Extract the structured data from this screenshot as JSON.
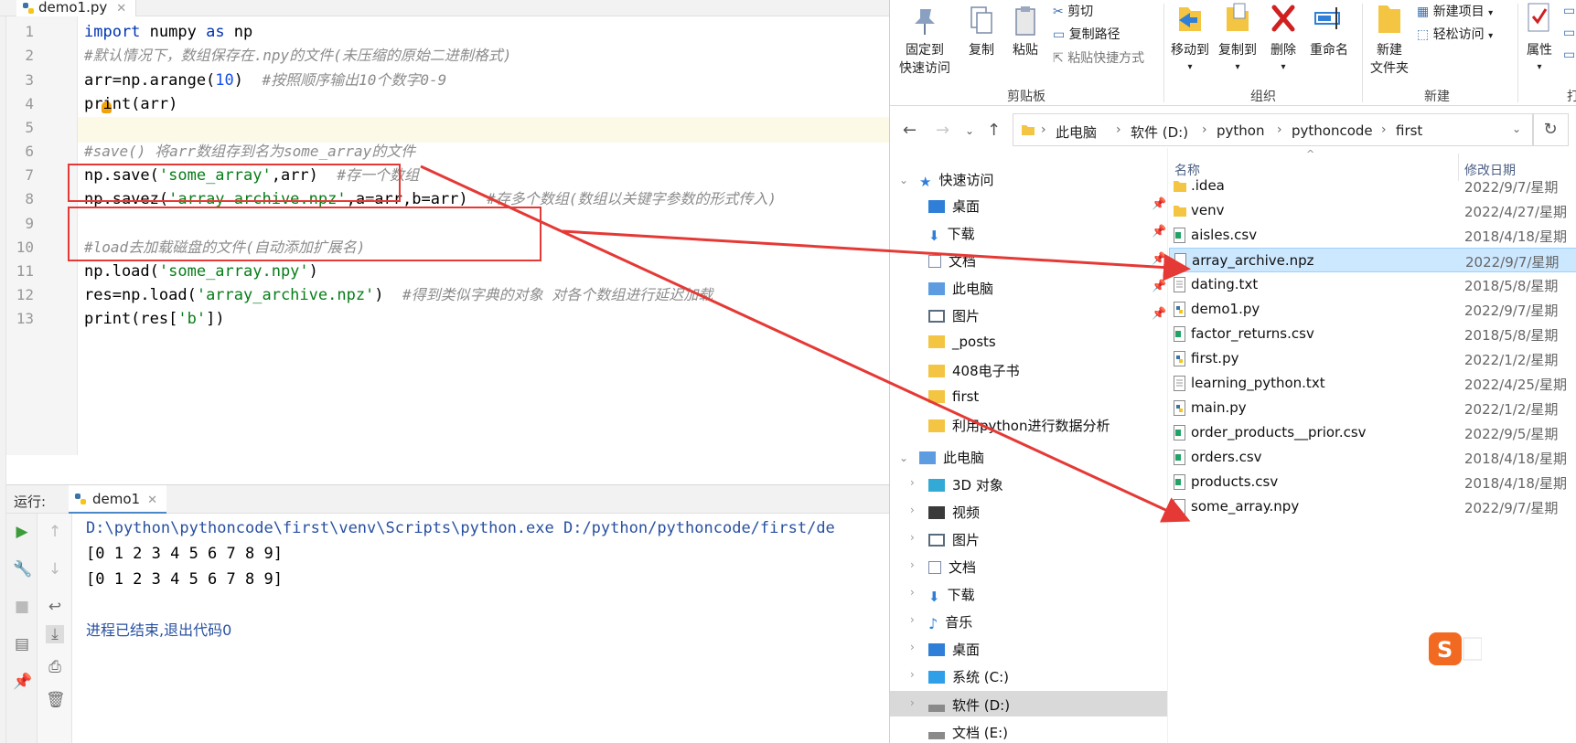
{
  "ide": {
    "tab": "demo1.py",
    "code_lines": [
      {
        "n": "1"
      },
      {
        "n": "2"
      },
      {
        "n": "3"
      },
      {
        "n": "4"
      },
      {
        "n": "5"
      },
      {
        "n": "6"
      },
      {
        "n": "7"
      },
      {
        "n": "8"
      },
      {
        "n": "9"
      },
      {
        "n": "10"
      },
      {
        "n": "11"
      },
      {
        "n": "12"
      },
      {
        "n": "13"
      }
    ],
    "code": {
      "l1": {
        "kw1": "import",
        "mid": " numpy ",
        "kw2": "as",
        "tail": " np"
      },
      "l2": "#默认情况下，数组保存在.npy的文件(未压缩的原始二进制格式)",
      "l3": {
        "a": "arr=np.arange(",
        "num": "10",
        "b": ")  ",
        "c": "#按照顺序输出10个数字0-9"
      },
      "l4": "print(arr)",
      "l6": "#save() 将arr数组存到名为some_array的文件",
      "l7": {
        "a": "np.save(",
        "s": "'some_array'",
        "b": ",arr)  ",
        "c": "#存一个数组"
      },
      "l8": {
        "a": "np.savez(",
        "s": "'array_archive.npz'",
        "b": ",a=arr,b=arr)  ",
        "c": "#存多个数组(数组以关键字参数的形式传入)"
      },
      "l10": "#load去加载磁盘的文件(自动添加扩展名)",
      "l11": {
        "a": "np.load(",
        "s": "'some_array.npy'",
        "b": ")"
      },
      "l12": {
        "a": "res=np.load(",
        "s": "'array_archive.npz'",
        "b": ")  ",
        "c": "#得到类似字典的对象 对各个数组进行延迟加载"
      },
      "l13": {
        "a": "print(res[",
        "s": "'b'",
        "b": "])"
      }
    },
    "run": {
      "label": "运行:",
      "tab": "demo1",
      "output": [
        "D:\\python\\pythoncode\\first\\venv\\Scripts\\python.exe D:/python/pythoncode/first/de",
        "[0 1 2 3 4 5 6 7 8 9]",
        "[0 1 2 3 4 5 6 7 8 9]",
        "进程已结束,退出代码0"
      ]
    }
  },
  "explorer": {
    "ribbon": {
      "pin": [
        "固定到",
        "快速访问"
      ],
      "copy": "复制",
      "paste": "粘贴",
      "cut": "剪切",
      "copy_path": "复制路径",
      "paste_shortcut": "粘贴快捷方式",
      "move_to": "移动到",
      "copy_to": "复制到",
      "delete": "删除",
      "rename": "重命名",
      "new_folder": [
        "新建",
        "文件夹"
      ],
      "new_item": "新建项目",
      "easy_access": "轻松访问",
      "properties": "属性",
      "groups": {
        "clipboard": "剪贴板",
        "organize": "组织",
        "new": "新建",
        "open": "打"
      }
    },
    "breadcrumb": [
      "此电脑",
      "软件 (D:)",
      "python",
      "pythoncode",
      "first"
    ],
    "nav": {
      "quick_access": "快速访问",
      "qa_items": [
        "桌面",
        "下载",
        "文档",
        "此电脑",
        "图片",
        "_posts",
        "408电子书",
        "first",
        "利用python进行数据分析"
      ],
      "this_pc": "此电脑",
      "pc_items": [
        "3D 对象",
        "视频",
        "图片",
        "文档",
        "下载",
        "音乐",
        "桌面",
        "系统 (C:)",
        "软件 (D:)",
        "文档 (E:)"
      ]
    },
    "columns": {
      "name": "名称",
      "date": "修改日期"
    },
    "files": [
      {
        "name": ".idea",
        "date": "2022/9/7/星期",
        "type": "folder"
      },
      {
        "name": "venv",
        "date": "2022/4/27/星期",
        "type": "folder"
      },
      {
        "name": "aisles.csv",
        "date": "2018/4/18/星期",
        "type": "csv"
      },
      {
        "name": "array_archive.npz",
        "date": "2022/9/7/星期",
        "type": "file"
      },
      {
        "name": "dating.txt",
        "date": "2018/5/8/星期",
        "type": "txt"
      },
      {
        "name": "demo1.py",
        "date": "2022/9/7/星期",
        "type": "py"
      },
      {
        "name": "factor_returns.csv",
        "date": "2018/5/8/星期",
        "type": "csv"
      },
      {
        "name": "first.py",
        "date": "2022/1/2/星期",
        "type": "py"
      },
      {
        "name": "learning_python.txt",
        "date": "2022/4/25/星期",
        "type": "txt"
      },
      {
        "name": "main.py",
        "date": "2022/1/2/星期",
        "type": "py"
      },
      {
        "name": "order_products__prior.csv",
        "date": "2022/9/5/星期",
        "type": "csv"
      },
      {
        "name": "orders.csv",
        "date": "2018/4/18/星期",
        "type": "csv"
      },
      {
        "name": "products.csv",
        "date": "2018/4/18/星期",
        "type": "csv"
      },
      {
        "name": "some_array.npy",
        "date": "2022/9/7/星期",
        "type": "file"
      }
    ]
  },
  "colors": {
    "annotation": "#e53935",
    "selection": "#cce8ff",
    "accent": "#1e6fd0"
  }
}
